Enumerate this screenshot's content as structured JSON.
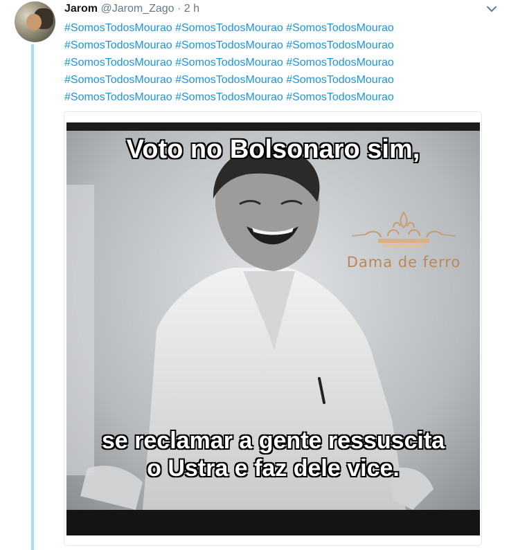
{
  "tweet": {
    "author_name": "Jarom",
    "author_handle": "@Jarom_Zago",
    "separator": "·",
    "timestamp": "2 h",
    "hashtag_lines": [
      [
        "#SomosTodosMourao",
        "#SomosTodosMourao",
        "#SomosTodosMourao"
      ],
      [
        "#SomosTodosMourao",
        "#SomosTodosMourao",
        "#SomosTodosMourao"
      ],
      [
        "#SomosTodosMourao",
        "#SomosTodosMourao",
        "#SomosTodosMourao"
      ],
      [
        "#SomosTodosMourao",
        "#SomosTodosMourao",
        "#SomosTodosMourao"
      ],
      [
        "#SomosTodosMourao",
        "#SomosTodosMourao",
        "#SomosTodosMourao"
      ]
    ]
  },
  "media": {
    "caption_top": "Voto no Bolsonaro sim,",
    "caption_bottom_1": "se reclamar a gente ressuscita",
    "caption_bottom_2": "o Ustra e faz dele vice.",
    "watermark": "Dama de ferro"
  },
  "icons": {
    "more": "chevron-down-icon",
    "watermark": "crown-icon"
  },
  "colors": {
    "hashtag": "#1b95e0",
    "thread_line": "#a8dcf2",
    "muted": "#657786",
    "watermark": "#b98857"
  }
}
